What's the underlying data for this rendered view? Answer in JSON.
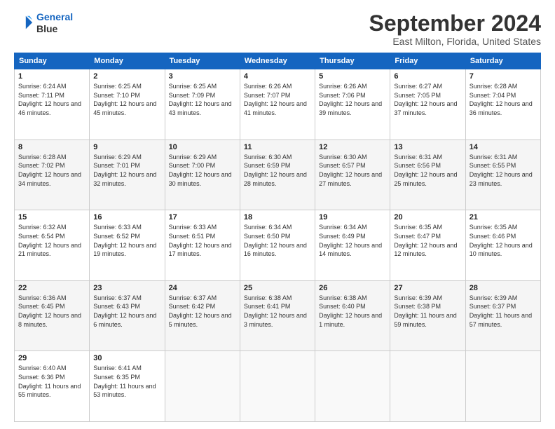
{
  "logo": {
    "line1": "General",
    "line2": "Blue"
  },
  "title": "September 2024",
  "subtitle": "East Milton, Florida, United States",
  "days_header": [
    "Sunday",
    "Monday",
    "Tuesday",
    "Wednesday",
    "Thursday",
    "Friday",
    "Saturday"
  ],
  "weeks": [
    [
      {
        "num": "1",
        "rise": "6:24 AM",
        "set": "7:11 PM",
        "daylight": "12 hours and 46 minutes."
      },
      {
        "num": "2",
        "rise": "6:25 AM",
        "set": "7:10 PM",
        "daylight": "12 hours and 45 minutes."
      },
      {
        "num": "3",
        "rise": "6:25 AM",
        "set": "7:09 PM",
        "daylight": "12 hours and 43 minutes."
      },
      {
        "num": "4",
        "rise": "6:26 AM",
        "set": "7:07 PM",
        "daylight": "12 hours and 41 minutes."
      },
      {
        "num": "5",
        "rise": "6:26 AM",
        "set": "7:06 PM",
        "daylight": "12 hours and 39 minutes."
      },
      {
        "num": "6",
        "rise": "6:27 AM",
        "set": "7:05 PM",
        "daylight": "12 hours and 37 minutes."
      },
      {
        "num": "7",
        "rise": "6:28 AM",
        "set": "7:04 PM",
        "daylight": "12 hours and 36 minutes."
      }
    ],
    [
      {
        "num": "8",
        "rise": "6:28 AM",
        "set": "7:02 PM",
        "daylight": "12 hours and 34 minutes."
      },
      {
        "num": "9",
        "rise": "6:29 AM",
        "set": "7:01 PM",
        "daylight": "12 hours and 32 minutes."
      },
      {
        "num": "10",
        "rise": "6:29 AM",
        "set": "7:00 PM",
        "daylight": "12 hours and 30 minutes."
      },
      {
        "num": "11",
        "rise": "6:30 AM",
        "set": "6:59 PM",
        "daylight": "12 hours and 28 minutes."
      },
      {
        "num": "12",
        "rise": "6:30 AM",
        "set": "6:57 PM",
        "daylight": "12 hours and 27 minutes."
      },
      {
        "num": "13",
        "rise": "6:31 AM",
        "set": "6:56 PM",
        "daylight": "12 hours and 25 minutes."
      },
      {
        "num": "14",
        "rise": "6:31 AM",
        "set": "6:55 PM",
        "daylight": "12 hours and 23 minutes."
      }
    ],
    [
      {
        "num": "15",
        "rise": "6:32 AM",
        "set": "6:54 PM",
        "daylight": "12 hours and 21 minutes."
      },
      {
        "num": "16",
        "rise": "6:33 AM",
        "set": "6:52 PM",
        "daylight": "12 hours and 19 minutes."
      },
      {
        "num": "17",
        "rise": "6:33 AM",
        "set": "6:51 PM",
        "daylight": "12 hours and 17 minutes."
      },
      {
        "num": "18",
        "rise": "6:34 AM",
        "set": "6:50 PM",
        "daylight": "12 hours and 16 minutes."
      },
      {
        "num": "19",
        "rise": "6:34 AM",
        "set": "6:49 PM",
        "daylight": "12 hours and 14 minutes."
      },
      {
        "num": "20",
        "rise": "6:35 AM",
        "set": "6:47 PM",
        "daylight": "12 hours and 12 minutes."
      },
      {
        "num": "21",
        "rise": "6:35 AM",
        "set": "6:46 PM",
        "daylight": "12 hours and 10 minutes."
      }
    ],
    [
      {
        "num": "22",
        "rise": "6:36 AM",
        "set": "6:45 PM",
        "daylight": "12 hours and 8 minutes."
      },
      {
        "num": "23",
        "rise": "6:37 AM",
        "set": "6:43 PM",
        "daylight": "12 hours and 6 minutes."
      },
      {
        "num": "24",
        "rise": "6:37 AM",
        "set": "6:42 PM",
        "daylight": "12 hours and 5 minutes."
      },
      {
        "num": "25",
        "rise": "6:38 AM",
        "set": "6:41 PM",
        "daylight": "12 hours and 3 minutes."
      },
      {
        "num": "26",
        "rise": "6:38 AM",
        "set": "6:40 PM",
        "daylight": "12 hours and 1 minute."
      },
      {
        "num": "27",
        "rise": "6:39 AM",
        "set": "6:38 PM",
        "daylight": "11 hours and 59 minutes."
      },
      {
        "num": "28",
        "rise": "6:39 AM",
        "set": "6:37 PM",
        "daylight": "11 hours and 57 minutes."
      }
    ],
    [
      {
        "num": "29",
        "rise": "6:40 AM",
        "set": "6:36 PM",
        "daylight": "11 hours and 55 minutes."
      },
      {
        "num": "30",
        "rise": "6:41 AM",
        "set": "6:35 PM",
        "daylight": "11 hours and 53 minutes."
      },
      null,
      null,
      null,
      null,
      null
    ]
  ]
}
